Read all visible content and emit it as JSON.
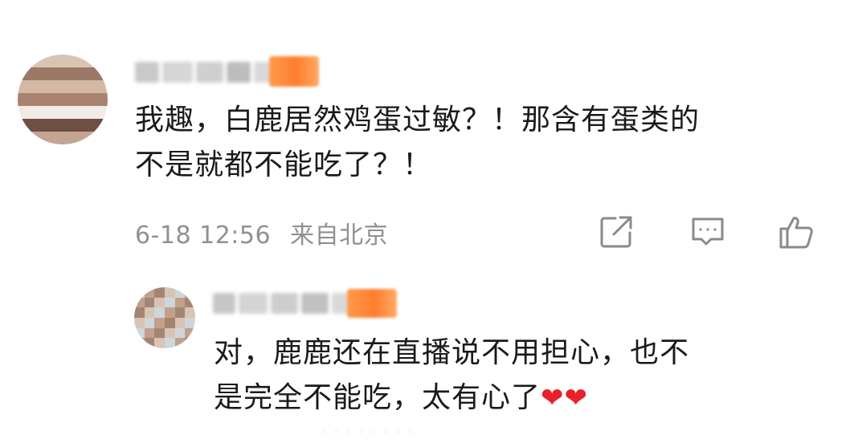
{
  "main_comment": {
    "text_line_1": "我趣，白鹿居然鸡蛋过敏？！那含有蛋类的",
    "text_line_2": "不是就都不能吃了？！",
    "date": "6-18 12:56",
    "location": "来自北京",
    "username_obscured": true,
    "avatar_obscured": true
  },
  "actions": {
    "share_icon": "share-icon",
    "comment_icon": "comment-icon",
    "like_icon": "thumbs-up-icon"
  },
  "reply": {
    "text_line_1": "对，鹿鹿还在直播说不用担心，也不",
    "text_line_2": "是完全不能吃，太有心了",
    "emoji": "❤❤",
    "username_obscured": true,
    "avatar_obscured": true
  },
  "colors": {
    "text": "#1a1a1a",
    "meta": "#909090",
    "badge": "#ff7d2e",
    "heart": "#e8202a",
    "icon": "#8a8a8a"
  }
}
